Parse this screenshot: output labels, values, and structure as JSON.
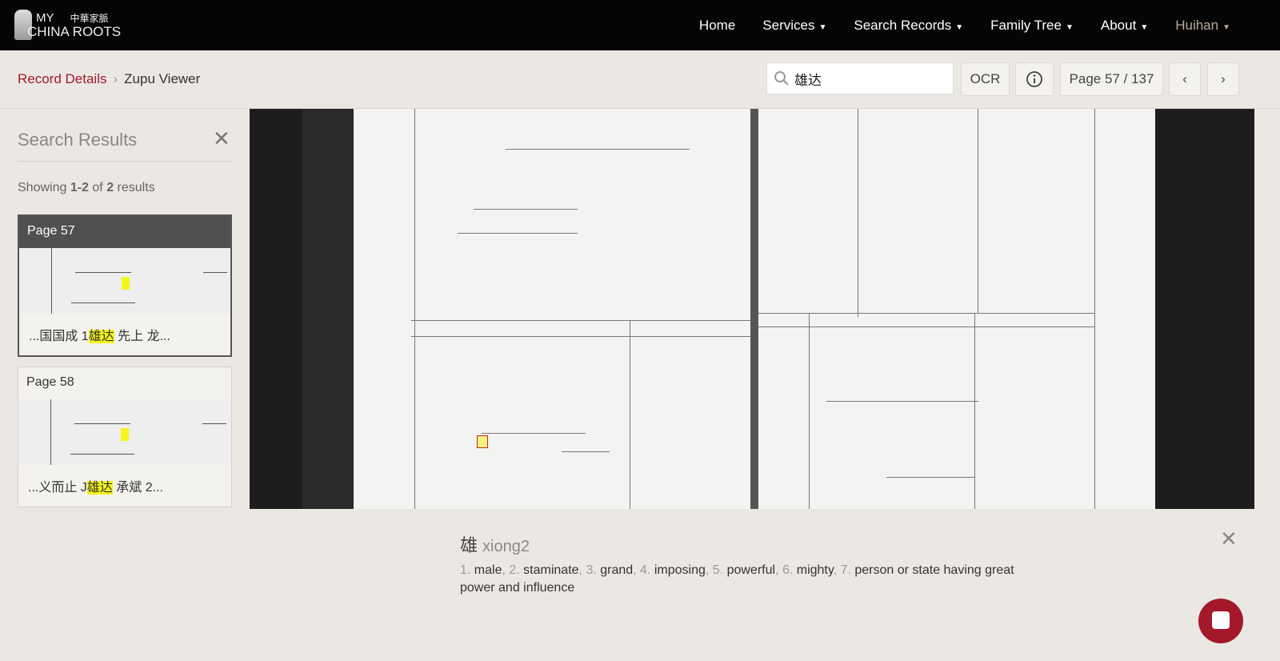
{
  "header": {
    "logo_text_en_1": "MY",
    "logo_text_zh": "中華家脈",
    "logo_text_en_2": "CHINA ROOTS",
    "nav": [
      {
        "label": "Home",
        "dropdown": false
      },
      {
        "label": "Services",
        "dropdown": true
      },
      {
        "label": "Search Records",
        "dropdown": true
      },
      {
        "label": "Family Tree",
        "dropdown": true
      },
      {
        "label": "About",
        "dropdown": true
      },
      {
        "label": "Huihan",
        "dropdown": true
      }
    ]
  },
  "breadcrumb": {
    "parent": "Record Details",
    "current": "Zupu Viewer"
  },
  "toolbar": {
    "search_value": "雄达",
    "ocr_label": "OCR",
    "info_icon": "info-circle-icon",
    "page_label": "Page 57 / 137",
    "prev_icon": "chevron-left-icon",
    "next_icon": "chevron-right-icon"
  },
  "sidebar": {
    "title": "Search Results",
    "showing_prefix": "Showing ",
    "showing_range": "1-2",
    "showing_of": " of ",
    "showing_total": "2",
    "showing_suffix": " results",
    "results": [
      {
        "page": "Page 57",
        "before": "...国国成 1",
        "match": "雄达",
        "after": " 先上 龙...",
        "active": true
      },
      {
        "page": "Page 58",
        "before": "...义而止 J",
        "match": "雄达",
        "after": " 承斌 2...",
        "active": false
      }
    ]
  },
  "definition": {
    "character": "雄",
    "pinyin": "xiong2",
    "meanings": [
      {
        "n": "1.",
        "t": "male"
      },
      {
        "n": "2.",
        "t": "staminate"
      },
      {
        "n": "3.",
        "t": "grand"
      },
      {
        "n": "4.",
        "t": "imposing"
      },
      {
        "n": "5.",
        "t": "powerful"
      },
      {
        "n": "6.",
        "t": "mighty"
      },
      {
        "n": "7.",
        "t": "person or state having great power and influence"
      }
    ]
  },
  "colors": {
    "brand": "#a3192b",
    "highlight": "#f5f51a",
    "header_bg": "#050505"
  }
}
